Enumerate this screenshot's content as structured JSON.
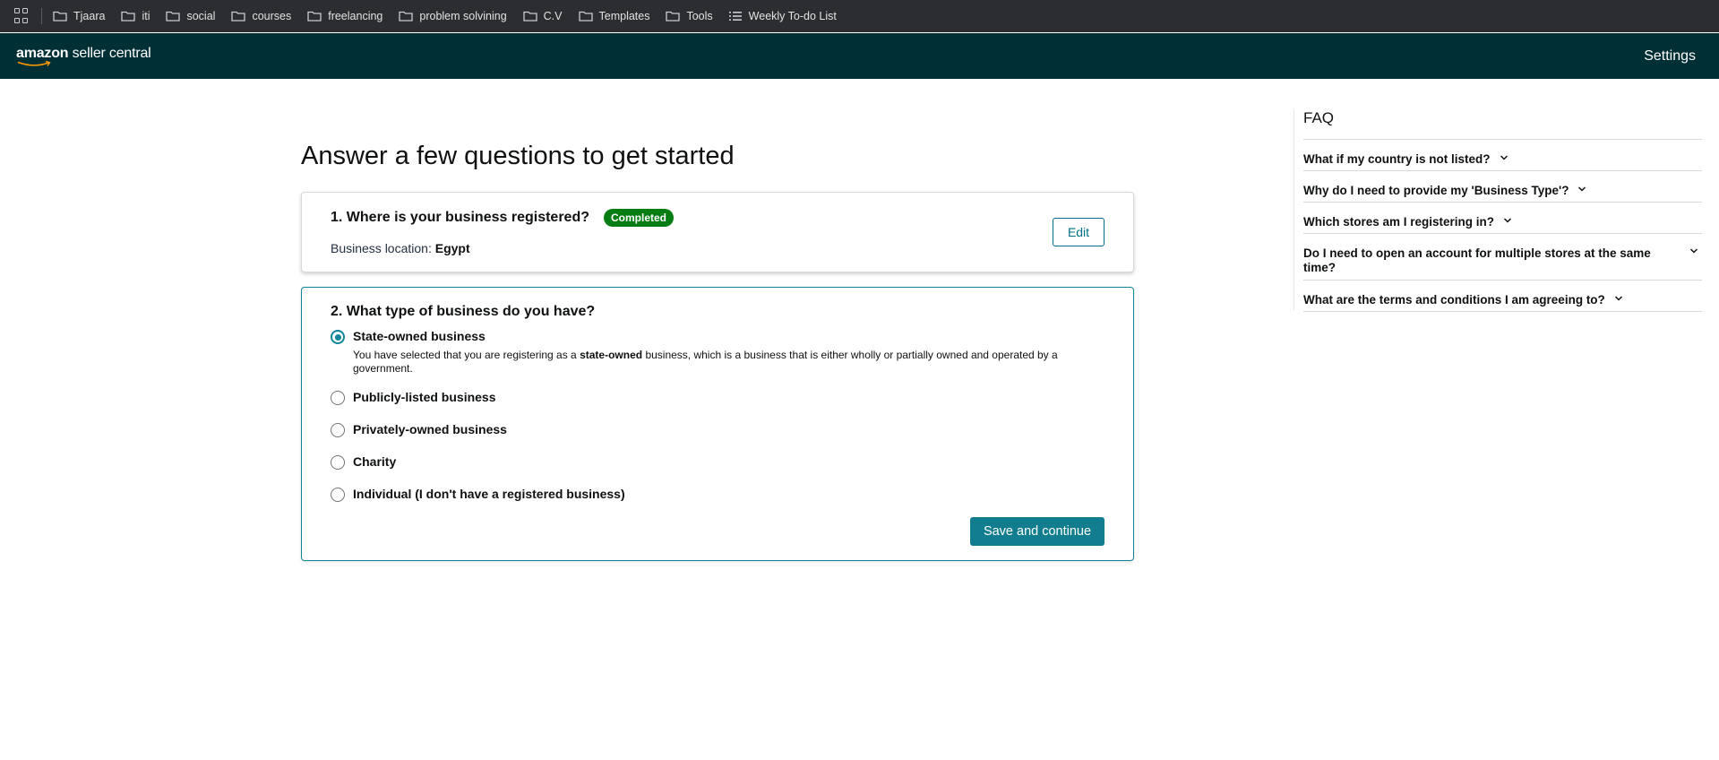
{
  "bookmarks": {
    "items": [
      {
        "label": "Tjaara",
        "icon": "folder-icon"
      },
      {
        "label": "iti",
        "icon": "folder-icon"
      },
      {
        "label": "social",
        "icon": "folder-icon"
      },
      {
        "label": "courses",
        "icon": "folder-icon"
      },
      {
        "label": "freelancing",
        "icon": "folder-icon"
      },
      {
        "label": "problem solvining",
        "icon": "folder-icon"
      },
      {
        "label": "C.V",
        "icon": "folder-icon"
      },
      {
        "label": "Templates",
        "icon": "folder-icon"
      },
      {
        "label": "Tools",
        "icon": "folder-icon"
      },
      {
        "label": "Weekly To-do List",
        "icon": "list-icon"
      }
    ]
  },
  "header": {
    "logo_brand": "amazon",
    "logo_product": "seller central",
    "settings_label": "Settings"
  },
  "main": {
    "page_title": "Answer a few questions to get started",
    "question1": {
      "title": "1. Where is your business registered?",
      "badge": "Completed",
      "location_label": "Business location:",
      "location_value": "Egypt",
      "edit_label": "Edit"
    },
    "question2": {
      "title": "2. What type of business do you have?",
      "options": [
        {
          "label": "State-owned business",
          "checked": true
        },
        {
          "label": "Publicly-listed business",
          "checked": false
        },
        {
          "label": "Privately-owned business",
          "checked": false
        },
        {
          "label": "Charity",
          "checked": false
        },
        {
          "label": "Individual (I don't have a registered business)",
          "checked": false
        }
      ],
      "selected_desc_pre": "You have selected that you are registering as a",
      "selected_desc_bold": "state-owned",
      "selected_desc_post": "business, which is a business that is either wholly or partially owned and operated by a government.",
      "save_label": "Save and continue"
    }
  },
  "faq": {
    "title": "FAQ",
    "items": [
      "What if my country is not listed?",
      "Why do I need to provide my 'Business Type'?",
      "Which stores am I registering in?",
      "Do I need to open an account for multiple stores at the same time?",
      "What are the terms and conditions I am agreeing to?"
    ]
  },
  "colors": {
    "header_bg": "#002f36",
    "accent": "#10859a",
    "button_bg": "#117d8f",
    "badge_bg": "#067d12",
    "bookmarks_bg": "#2b2d31"
  }
}
